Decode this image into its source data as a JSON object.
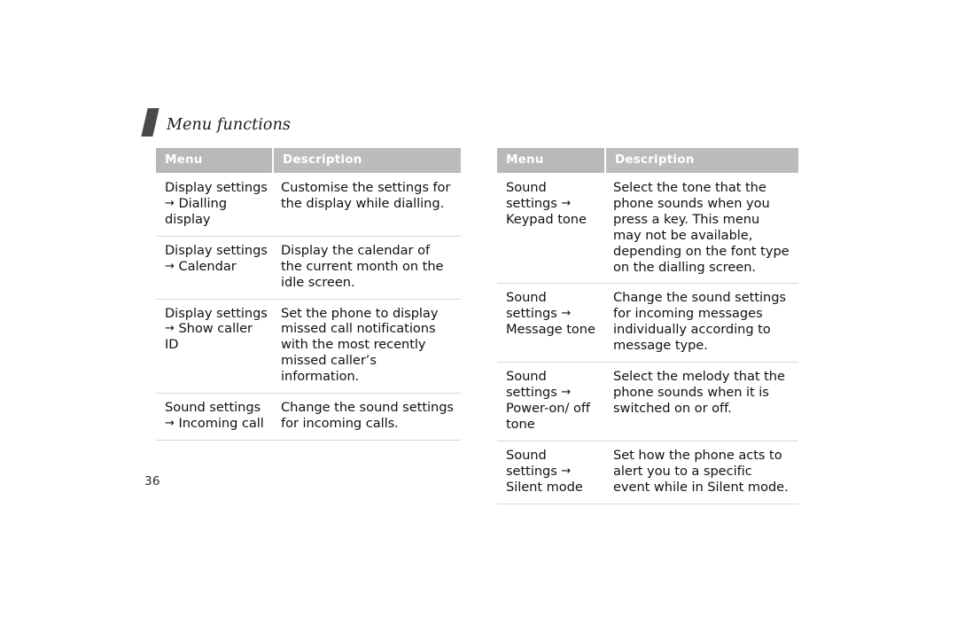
{
  "header": {
    "title": "Menu functions",
    "mark_color": "#4a4a4a"
  },
  "folio": {
    "page_number": "36"
  },
  "colors": {
    "header_menu_bg": "#b8b8b8",
    "header_desc_bg": "#bcbcbc",
    "header_text": "#ffffff",
    "rule": "#d7d7d7",
    "body_text": "#111111"
  },
  "tables": [
    {
      "id": "left",
      "columns": [
        "Menu",
        "Description"
      ],
      "rows": [
        {
          "menu_line1": "Display",
          "menu_line2": "settings",
          "arrow": "→",
          "menu_line3": "Dialling display",
          "description": "Customise the settings for the display while dialling."
        },
        {
          "menu_line1": "Display",
          "menu_line2": "settings",
          "arrow": "→",
          "menu_line3": "Calendar",
          "description": "Display the calendar of the current month on the idle screen."
        },
        {
          "menu_line1": "Display",
          "menu_line2": "settings",
          "arrow": "→",
          "menu_line3": "Show caller ID",
          "description": "Set the phone to display missed call notifications with the most recently missed caller’s information."
        },
        {
          "menu_line1": "Sound settings",
          "menu_line2": "",
          "arrow": "→",
          "menu_line3": "Incoming call",
          "description": "Change the sound settings for incoming calls."
        }
      ]
    },
    {
      "id": "right",
      "columns": [
        "Menu",
        "Description"
      ],
      "rows": [
        {
          "menu_line1": "Sound settings",
          "menu_line2": "",
          "arrow": "→",
          "menu_line3": "Keypad tone",
          "description": "Select the tone that the phone sounds when you press a key. This menu may not be available, depending on the font type on the dialling screen."
        },
        {
          "menu_line1": "Sound settings",
          "menu_line2": "",
          "arrow": "→",
          "menu_line3": "Message tone",
          "description": "Change the sound settings for incoming messages individually according to message type."
        },
        {
          "menu_line1": "Sound settings",
          "menu_line2": "",
          "arrow": "→",
          "menu_line3": "Power-on/ off tone",
          "description": "Select the melody that the phone sounds when it is switched on or off."
        },
        {
          "menu_line1": "Sound settings",
          "menu_line2": "",
          "arrow": "→",
          "menu_line3": "Silent mode",
          "description": "Set how the phone acts to alert you to a specific event while in Silent mode."
        }
      ]
    }
  ]
}
